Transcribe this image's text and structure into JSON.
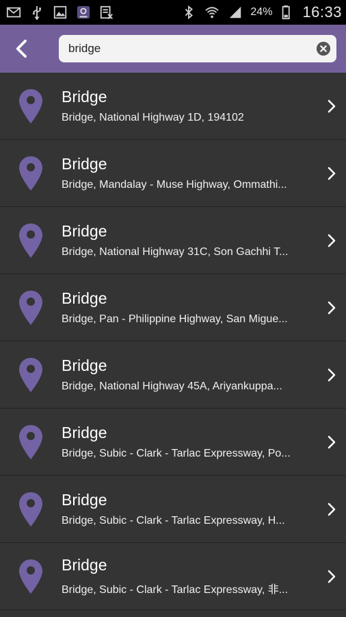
{
  "status_bar": {
    "battery_percent": "24%",
    "time": "16:33",
    "icons": [
      "mail-icon",
      "usb-icon",
      "image-icon",
      "app-icon",
      "cancel-doc-icon",
      "bluetooth-icon",
      "wifi-icon",
      "signal-icon",
      "battery-icon"
    ]
  },
  "search": {
    "value": "bridge"
  },
  "colors": {
    "accent": "#73609b",
    "pin": "#7363a4"
  },
  "results": [
    {
      "title": "Bridge",
      "subtitle": "Bridge, National Highway 1D, 194102"
    },
    {
      "title": "Bridge",
      "subtitle": "Bridge, Mandalay - Muse Highway, Ommathi..."
    },
    {
      "title": "Bridge",
      "subtitle": "Bridge, National Highway 31C, Son Gachhi T..."
    },
    {
      "title": "Bridge",
      "subtitle": "Bridge, Pan - Philippine Highway, San Migue..."
    },
    {
      "title": "Bridge",
      "subtitle": "Bridge, National Highway 45A, Ariyankuppa..."
    },
    {
      "title": "Bridge",
      "subtitle": "Bridge, Subic - Clark - Tarlac Expressway, Po..."
    },
    {
      "title": "Bridge",
      "subtitle": "Bridge, Subic - Clark - Tarlac Expressway, H..."
    },
    {
      "title": "Bridge",
      "subtitle": "Bridge, Subic - Clark - Tarlac Expressway, 非..."
    }
  ]
}
